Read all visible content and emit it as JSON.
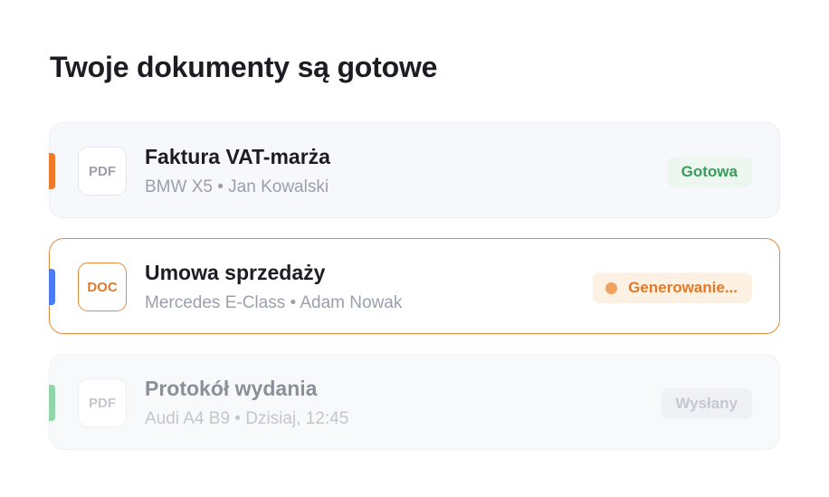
{
  "heading": "Twoje dokumenty są gotowe",
  "documents": [
    {
      "type": "PDF",
      "name": "Faktura VAT-marża",
      "meta": "BMW X5 • Jan Kowalski",
      "status": "Gotowa",
      "status_kind": "ready",
      "accent": "#ef7a2b"
    },
    {
      "type": "DOC",
      "name": "Umowa sprzedaży",
      "meta": "Mercedes E-Class • Adam Nowak",
      "status": "Generowanie...",
      "status_kind": "generating",
      "accent": "#4b7bf5"
    },
    {
      "type": "PDF",
      "name": "Protokół wydania",
      "meta": "Audi A4 B9 • Dzisiaj, 12:45",
      "status": "Wysłany",
      "status_kind": "sent",
      "accent": "#8fd6a8"
    }
  ],
  "colors": {
    "ready": "#3a9a5c",
    "generating": "#e07a2a",
    "sent": "#c4c8cf",
    "active_border": "#e58a3c"
  }
}
